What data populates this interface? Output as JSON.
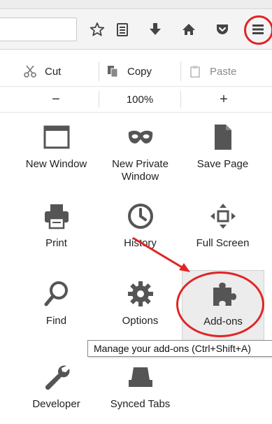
{
  "toolbar": {
    "icons": [
      "star-icon",
      "reading-list-icon",
      "download-icon",
      "home-icon",
      "pocket-icon",
      "hamburger-menu-icon"
    ]
  },
  "edit": {
    "cut_label": "Cut",
    "copy_label": "Copy",
    "paste_label": "Paste"
  },
  "zoom": {
    "minus": "−",
    "level": "100%",
    "plus": "+"
  },
  "menu": {
    "new_window": "New Window",
    "new_private_window": "New Private Window",
    "save_page": "Save Page",
    "print": "Print",
    "history": "History",
    "full_screen": "Full Screen",
    "find": "Find",
    "options": "Options",
    "add_ons": "Add-ons",
    "developer": "Developer",
    "synced_tabs": "Synced Tabs"
  },
  "tooltip": {
    "text": "Manage your add-ons (Ctrl+Shift+A)"
  },
  "colors": {
    "icon": "#555555",
    "annotation_red": "#e02525",
    "hover_bg": "#ececec"
  }
}
